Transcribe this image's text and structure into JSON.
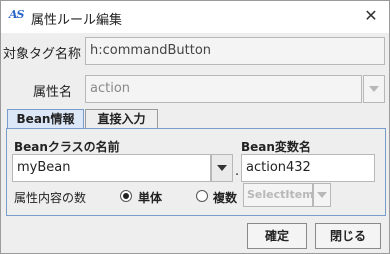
{
  "window": {
    "title": "属性ルール編集",
    "app_icon_text": "AS"
  },
  "target_tag": {
    "label": "対象タグ名称",
    "value": "h:commandButton"
  },
  "attribute": {
    "label": "属性名",
    "value": "action"
  },
  "tabs": [
    {
      "label": "Bean情報",
      "active": true
    },
    {
      "label": "直接入力",
      "active": false
    }
  ],
  "bean": {
    "class_label": "Beanクラスの名前",
    "class_value": "myBean",
    "separator": ".",
    "var_label": "Bean変数名",
    "var_value": "action432",
    "count_label": "属性内容の数",
    "single_label": "単体",
    "multiple_label": "複数",
    "selected": "single",
    "select_item_value": "SelectItem"
  },
  "buttons": {
    "ok": "確定",
    "close": "閉じる"
  }
}
